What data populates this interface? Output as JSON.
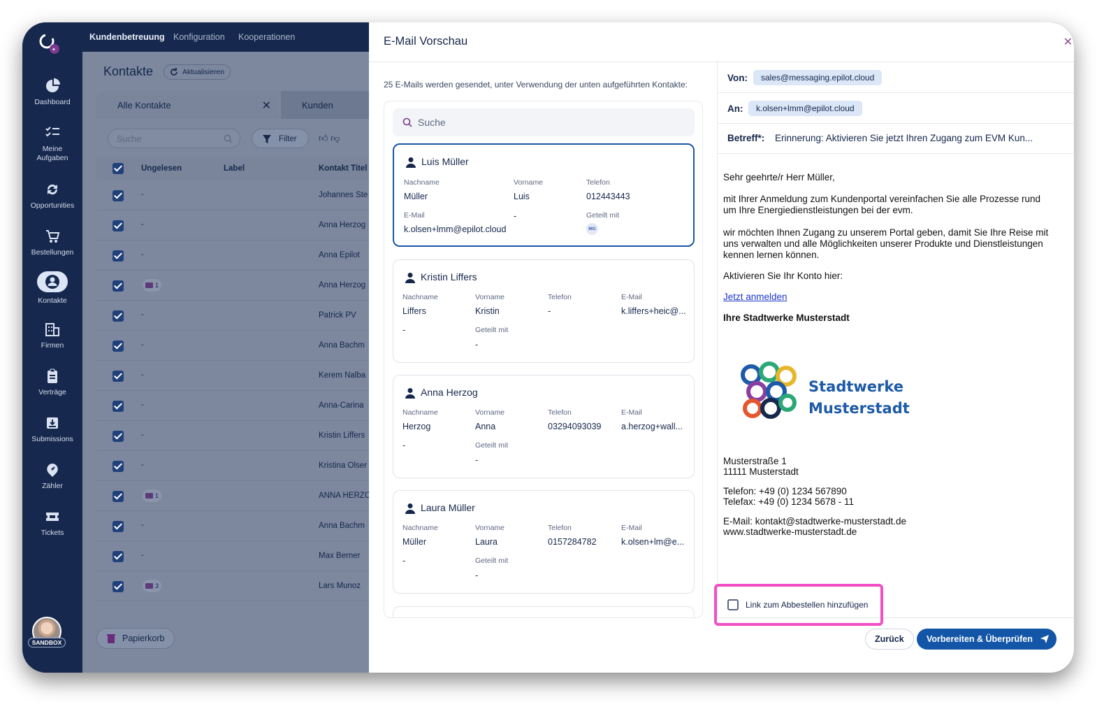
{
  "top_nav": [
    "Kundenbetreuung",
    "Konfiguration",
    "Kooperationen"
  ],
  "sidebar": {
    "items": [
      {
        "label": "Dashboard",
        "icon": "pie-chart-icon"
      },
      {
        "label": "Meine Aufgaben",
        "icon": "task-list-icon"
      },
      {
        "label": "Opportunities",
        "icon": "cycle-icon"
      },
      {
        "label": "Bestellungen",
        "icon": "cart-icon"
      },
      {
        "label": "Kontakte",
        "icon": "person-icon",
        "active": true
      },
      {
        "label": "Firmen",
        "icon": "building-icon"
      },
      {
        "label": "Verträge",
        "icon": "clipboard-icon"
      },
      {
        "label": "Submissions",
        "icon": "inbox-icon"
      },
      {
        "label": "Zähler",
        "icon": "meter-icon"
      },
      {
        "label": "Tickets",
        "icon": "ticket-icon"
      }
    ],
    "sandbox_label": "SANDBOX"
  },
  "contacts_page": {
    "title": "Kontakte",
    "refresh_label": "Aktualisieren",
    "tabs": [
      "Alle Kontakte",
      "Kunden"
    ],
    "search_placeholder": "Suche",
    "filter_label": "Filter",
    "columns": [
      "Ungelesen",
      "Label",
      "Kontakt Titel"
    ],
    "rows": [
      {
        "unread": "-",
        "badge": null,
        "name": "Johannes Ste"
      },
      {
        "unread": "-",
        "badge": null,
        "name": "Anna Herzog"
      },
      {
        "unread": "-",
        "badge": null,
        "name": "Anna Epilot"
      },
      {
        "unread": "",
        "badge": "1",
        "name": "Anna Herzog"
      },
      {
        "unread": "-",
        "badge": null,
        "name": "Patrick PV"
      },
      {
        "unread": "-",
        "badge": null,
        "name": "Anna Bachm"
      },
      {
        "unread": "-",
        "badge": null,
        "name": "Kerem Nalba"
      },
      {
        "unread": "-",
        "badge": null,
        "name": "Anna-Carina"
      },
      {
        "unread": "-",
        "badge": null,
        "name": "Kristin Liffers"
      },
      {
        "unread": "-",
        "badge": null,
        "name": "Kristina Olser"
      },
      {
        "unread": "",
        "badge": "1",
        "name": "ANNA HERZO"
      },
      {
        "unread": "-",
        "badge": null,
        "name": "Anna Bachm"
      },
      {
        "unread": "-",
        "badge": null,
        "name": "Max Berner"
      },
      {
        "unread": "",
        "badge": "3",
        "name": "Lars Munoz"
      }
    ],
    "trash_label": "Papierkorb"
  },
  "modal": {
    "title": "E-Mail Vorschau",
    "info": "25 E-Mails werden gesendet, unter Verwendung der unten aufgeführten Kontakte:",
    "search_placeholder": "Suche",
    "field_labels": {
      "lastname": "Nachname",
      "firstname": "Vorname",
      "phone": "Telefon",
      "email": "E-Mail",
      "shared": "Geteilt mit"
    },
    "contacts": [
      {
        "name": "Luis Müller",
        "lastname": "Müller",
        "firstname": "Luis",
        "phone": "012443443",
        "email": "k.olsen+lmm@epilot.cloud",
        "email_extra": "-",
        "shared": "MG"
      },
      {
        "name": "Kristin Liffers",
        "lastname": "Liffers",
        "firstname": "Kristin",
        "phone": "-",
        "email": "k.liffers+heic@...",
        "extra": "-",
        "shared": "-"
      },
      {
        "name": "Anna Herzog",
        "lastname": "Herzog",
        "firstname": "Anna",
        "phone": "03294093039",
        "email": "a.herzog+wall...",
        "extra": "-",
        "shared": "-"
      },
      {
        "name": "Laura Müller",
        "lastname": "Müller",
        "firstname": "Laura",
        "phone": "0157284782",
        "email": "k.olsen+lm@e...",
        "extra": "-",
        "shared": "-"
      }
    ],
    "from_label": "Von:",
    "from_value": "sales@messaging.epilot.cloud",
    "to_label": "An:",
    "to_value": "k.olsen+lmm@epilot.cloud",
    "subject_label": "Betreff*:",
    "subject_value": "Erinnerung: Aktivieren Sie jetzt Ihren Zugang zum EVM Kun...",
    "email": {
      "greeting": "Sehr geehrte/r Herr Müller,",
      "para1": "mit Ihrer Anmeldung zum Kundenportal vereinfachen Sie alle Prozesse rund um Ihre Energiedienstleistungen bei der evm.",
      "para2": "wir möchten Ihnen Zugang zu unserem Portal geben, damit Sie Ihre Reise mit uns verwalten und alle Möglichkeiten unserer Produkte und Dienstleistungen kennen lernen können.",
      "para3": "Aktivieren Sie Ihr Konto hier:",
      "link": "Jetzt anmelden",
      "signature": "Ihre Stadtwerke Musterstadt",
      "brand_line1": "Stadtwerke",
      "brand_line2": "Musterstadt",
      "address1": "Musterstraße 1",
      "address2": "11111 Musterstadt",
      "phone": "Telefon: +49 (0) 1234 567890",
      "fax": "Telefax: +49 (0) 1234 5678 - 11",
      "mail": "E-Mail: kontakt@stadtwerke-musterstadt.de",
      "web": "www.stadtwerke-musterstadt.de"
    },
    "unsubscribe_label": "Link zum Abbestellen hinzufügen",
    "back_label": "Zurück",
    "prepare_label": "Vorbereiten & Überprüfen"
  },
  "colors": {
    "navy": "#16284d",
    "primary": "#1356a8",
    "highlight": "#f24fc4",
    "chip": "#dbe6f7"
  }
}
